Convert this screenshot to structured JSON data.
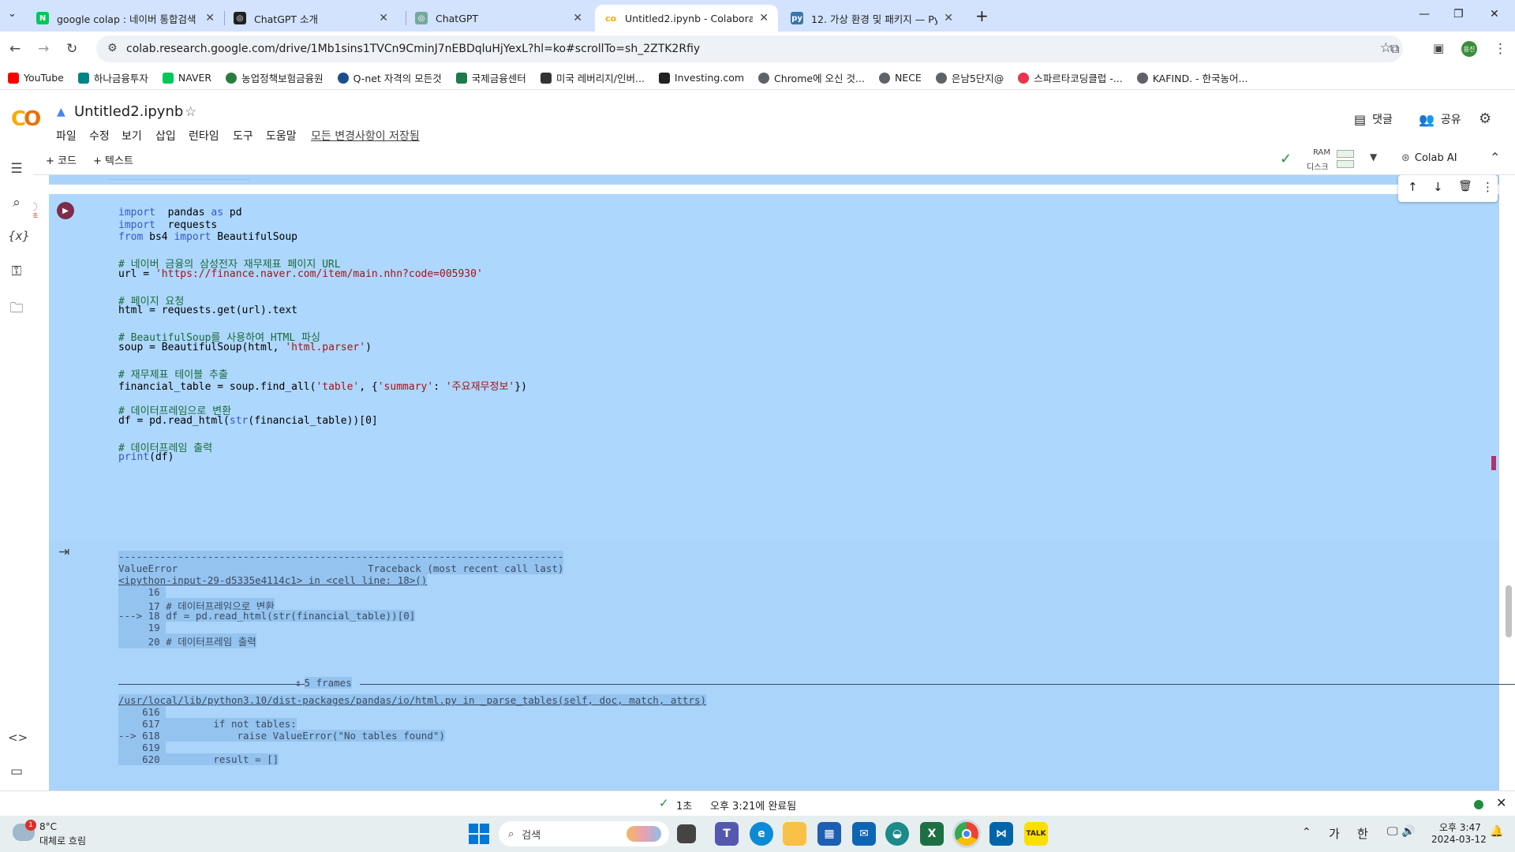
{
  "tabs": [
    {
      "title": "google colap : 네이버 통합검색",
      "fav_color": "#03c75a",
      "fav_letter": "N"
    },
    {
      "title": "ChatGPT 소개",
      "fav_color": "#202123",
      "fav_letter": "◎"
    },
    {
      "title": "ChatGPT",
      "fav_color": "#74aa9c",
      "fav_letter": "◎"
    },
    {
      "title": "Untitled2.ipynb - Colaboratory",
      "fav_color": "#f9ab00",
      "fav_letter": "co"
    },
    {
      "title": "12. 가상 환경 및 패키지 — Pyt",
      "fav_color": "#3776ab",
      "fav_letter": "py"
    }
  ],
  "address": "colab.research.google.com/drive/1Mb1sins1TVCn9CminJ7nEBDqluHjYexL?hl=ko#scrollTo=sh_2ZTK2Rfiy",
  "profile_badge": "용진",
  "bookmarks": [
    {
      "label": "YouTube",
      "color": "#ff0000"
    },
    {
      "label": "하나금융투자",
      "color": "#008485"
    },
    {
      "label": "NAVER",
      "color": "#03c75a"
    },
    {
      "label": "농업정책보험금융원",
      "color": "#2a7d3f"
    },
    {
      "label": "Q-net 자격의 모든것",
      "color": "#1b4d8f"
    },
    {
      "label": "국제금융센터",
      "color": "#1e7a4b"
    },
    {
      "label": "미국 레버리지/인버...",
      "color": "#333333"
    },
    {
      "label": "Investing.com",
      "color": "#222222"
    },
    {
      "label": "Chrome에 오신 것...",
      "color": "#5f6368"
    },
    {
      "label": "NECE",
      "color": "#5f6368"
    },
    {
      "label": "은남5단지@",
      "color": "#5f6368"
    },
    {
      "label": "스파르타코딩클럽 -...",
      "color": "#e8344e"
    },
    {
      "label": "KAFIND. - 한국농어...",
      "color": "#5f6368"
    }
  ],
  "colab": {
    "notebook_title": "Untitled2.ipynb",
    "menus": [
      "파일",
      "수정",
      "보기",
      "삽입",
      "런타임",
      "도구",
      "도움말"
    ],
    "saved_status": "모든 변경사항이 저장됨",
    "comment_label": "댓글",
    "share_label": "공유",
    "add_code": "+ 코드",
    "add_text": "+ 텍스트",
    "ram_label": "RAM",
    "disk_label": "디스크",
    "colab_ai_label": "Colab AI",
    "exec_time": "1초"
  },
  "code_lines": [
    [
      [
        "kw",
        "import"
      ],
      [
        "",
        "  pandas "
      ],
      [
        "kw",
        "as"
      ],
      [
        "",
        " pd"
      ]
    ],
    [
      [
        "kw",
        "import"
      ],
      [
        "",
        "  requests"
      ]
    ],
    [
      [
        "kw",
        "from"
      ],
      [
        "",
        " bs4 "
      ],
      [
        "kw",
        "import"
      ],
      [
        "",
        " BeautifulSoup"
      ]
    ],
    [],
    [
      [
        "cm",
        "# 네이버 금융의 삼성전자 재무제표 페이지 URL"
      ]
    ],
    [
      [
        "",
        "url = "
      ],
      [
        "st",
        "'https://finance.naver.com/item/main.nhn?code=005930'"
      ]
    ],
    [],
    [
      [
        "cm",
        "# 페이지 요청"
      ]
    ],
    [
      [
        "",
        "html = requests.get(url).text"
      ]
    ],
    [],
    [
      [
        "cm",
        "# BeautifulSoup를 사용하여 HTML 파싱"
      ]
    ],
    [
      [
        "",
        "soup = BeautifulSoup(html, "
      ],
      [
        "st",
        "'html.parser'"
      ],
      [
        "",
        ")"
      ]
    ],
    [],
    [
      [
        "cm",
        "# 재무제표 테이블 추출"
      ]
    ],
    [
      [
        "",
        "financial_table = soup.find_all("
      ],
      [
        "st",
        "'table'"
      ],
      [
        "",
        ", {"
      ],
      [
        "st",
        "'summary'"
      ],
      [
        "",
        ": "
      ],
      [
        "st",
        "'주요재무정보'"
      ],
      [
        "",
        "})"
      ]
    ],
    [],
    [
      [
        "cm",
        "# 데이터프레임으로 변환"
      ]
    ],
    [
      [
        "",
        "df = pd.read_html("
      ],
      [
        "kw",
        "str"
      ],
      [
        "",
        "(financial_table))[0]"
      ]
    ],
    [],
    [
      [
        "cm",
        "# 데이터프레임 출력"
      ]
    ],
    [
      [
        "kw",
        "print"
      ],
      [
        "",
        "(df)"
      ]
    ]
  ],
  "output_lines": [
    "---------------------------------------------------------------------------",
    "ValueError                                Traceback (most recent call last)",
    "<ipython-input-29-d5335e4114c1> in <cell line: 18>()",
    "     16 ",
    "     17 # 데이터프레임으로 변환",
    "---> 18 df = pd.read_html(str(financial_table))[0]",
    "     19 ",
    "     20 # 데이터프레임 출력"
  ],
  "frames_label": "5 frames",
  "output_lines2": [
    "/usr/local/lib/python3.10/dist-packages/pandas/io/html.py in _parse_tables(self, doc, match, attrs)",
    "    616 ",
    "    617         if not tables:",
    "--> 618             raise ValueError(\"No tables found\")",
    "    619 ",
    "    620         result = []"
  ],
  "status": {
    "check_time": "1초",
    "completed": "오후 3:21에 완료됨"
  },
  "taskbar": {
    "weather_temp": "8°C",
    "weather_desc": "대체로 흐림",
    "search_placeholder": "검색",
    "ime_1": "가",
    "ime_2": "한",
    "time": "오후 3:47",
    "date": "2024-03-12",
    "notif_count": "1"
  }
}
